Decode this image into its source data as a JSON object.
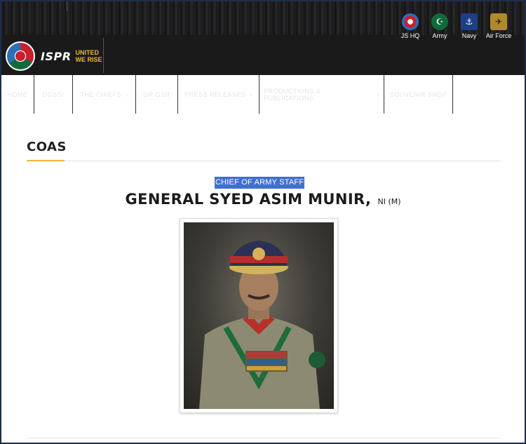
{
  "header": {
    "logo": {
      "text": "ISPR",
      "tagline_1": "UNITED",
      "tagline_2": "WE RISE"
    },
    "branches": [
      {
        "label": "JS HQ",
        "icon": "jshq-emblem-icon",
        "color": "#c9202d"
      },
      {
        "label": "Army",
        "icon": "army-emblem-icon",
        "color": "#0f6b3a"
      },
      {
        "label": "Navy",
        "icon": "navy-emblem-icon",
        "color": "#1e3e86"
      },
      {
        "label": "Air Force",
        "icon": "airforce-emblem-icon",
        "color": "#b08a2a"
      }
    ]
  },
  "nav": {
    "items": [
      {
        "label": "HOME",
        "has_dropdown": false
      },
      {
        "label": "DGSSI",
        "has_dropdown": false
      },
      {
        "label": "THE CHIEFS",
        "has_dropdown": true
      },
      {
        "label": "DR GSR",
        "has_dropdown": false
      },
      {
        "label": "PRESS RELEASES",
        "has_dropdown": true
      },
      {
        "label": "PRODUCTIONS & PUBLICATIONS",
        "has_dropdown": true
      },
      {
        "label": "SOUVENIR SHOP",
        "has_dropdown": false
      }
    ]
  },
  "content": {
    "section_title": "COAS",
    "role": "CHIEF OF ARMY STAFF",
    "name": "GENERAL SYED ASIM MUNIR,",
    "name_suffix": "NI (M)"
  },
  "colors": {
    "header_bg": "#1b1a1b",
    "accent_gold": "#e9b73d",
    "selection_blue": "#3f6fd1"
  }
}
